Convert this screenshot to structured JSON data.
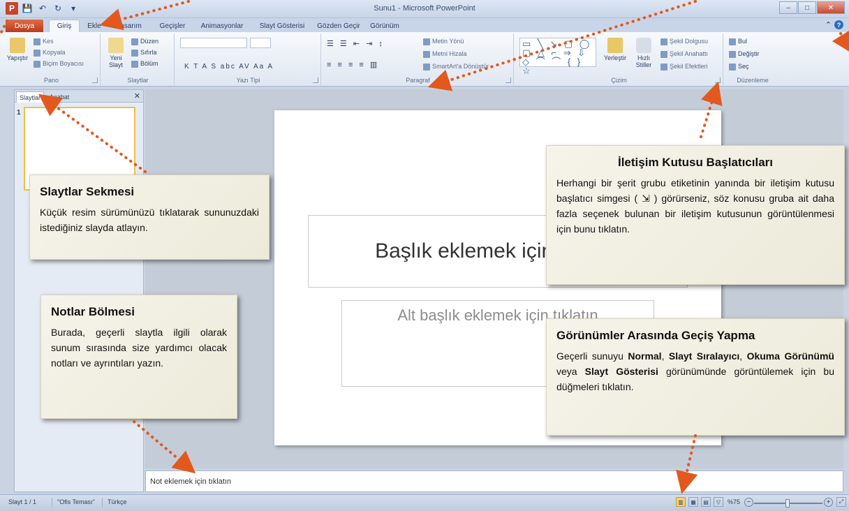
{
  "window": {
    "title": "Sunu1 - Microsoft PowerPoint",
    "minimize": "–",
    "maximize": "□",
    "close": "✕"
  },
  "qat": {
    "app_logo": "P",
    "save": "💾",
    "undo": "↶",
    "redo": "↻",
    "customize": "▾"
  },
  "tabs": {
    "file": "Dosya",
    "home": "Giriş",
    "insert": "Ekle",
    "design": "Tasarım",
    "transitions": "Geçişler",
    "animations": "Animasyonlar",
    "slideshow": "Slayt Gösterisi",
    "review": "Gözden Geçir",
    "view": "Görünüm",
    "help_caret": "⌃",
    "help": "?"
  },
  "ribbon": {
    "clipboard": {
      "label": "Pano",
      "paste": "Yapıştır",
      "cut": "Kes",
      "copy": "Kopyala",
      "format_painter": "Biçim Boyacısı"
    },
    "slides": {
      "label": "Slaytlar",
      "new_slide": "Yeni Slayt",
      "layout": "Düzen",
      "reset": "Sıfırla",
      "section": "Bölüm"
    },
    "font": {
      "label": "Yazı Tipi",
      "tools": "K  T  A  S  abc  AV  Aa  A"
    },
    "paragraph": {
      "label": "Paragraf",
      "text_direction": "Metin Yönü",
      "align_text": "Metni Hizala",
      "smartart": "SmartArt'a Dönüştür"
    },
    "drawing": {
      "label": "Çizim",
      "arrange": "Yerleştir",
      "quick_styles": "Hızlı Stiller",
      "shape_fill": "Şekil Dolgusu",
      "shape_outline": "Şekil Anahattı",
      "shape_effects": "Şekil Efektleri",
      "shapes": "▭ ╲ ↘ ▢ ◯ ▢ △ ⌐ ⇒ ⇩ ◇ ⌒ ⌒ { } ☆"
    },
    "editing": {
      "label": "Düzenleme",
      "find": "Bul",
      "replace": "Değiştir",
      "select": "Seç"
    }
  },
  "left_pane": {
    "tab_slides": "Slaytlar",
    "tab_outline": "Anahat",
    "close": "✕",
    "slide_number": "1"
  },
  "slide": {
    "title_placeholder": "Başlık eklemek için tıklatın",
    "subtitle_placeholder": "Alt başlık eklemek için tıklatın"
  },
  "notes": {
    "placeholder": "Not eklemek için tıklatın"
  },
  "status": {
    "slide": "Slayt 1 / 1",
    "theme": "\"Ofis Teması\"",
    "language": "Türkçe",
    "zoom": "%75",
    "zoom_minus": "−",
    "zoom_plus": "+",
    "fit": "⤢"
  },
  "callouts": {
    "slides_tab": {
      "title": "Slaytlar Sekmesi",
      "body": "Küçük resim sürümünüzü tıklatarak sununuzdaki istediğiniz slayda atlayın."
    },
    "notes_pane": {
      "title": "Notlar Bölmesi",
      "body": "Burada, geçerli slaytla ilgili olarak sunum sırasında size yardımcı olacak notları ve ayrıntıları yazın."
    },
    "dialog_launchers": {
      "title": "İletişim Kutusu Başlatıcıları",
      "body": "Herhangi bir şerit grubu etiketinin yanında bir iletişim kutusu başlatıcı simgesi ( ⇲ ) görürseniz, söz konusu gruba ait daha fazla seçenek bulunan bir iletişim kutusunun görüntülenmesi için bunu tıklatın."
    },
    "views": {
      "title": "Görünümler Arasında Geçiş Yapma",
      "body_1": "Geçerli sunuyu ",
      "normal": "Normal",
      "sep_1": ", ",
      "sorter": "Slayt Sıralayıcı",
      "sep_2": ", ",
      "reading": "Okuma Görünümü",
      "sep_3": " veya ",
      "slideshow": "Slayt Gösterisi",
      "body_2": " görünümünde görüntülemek için bu düğmeleri tıklatın."
    }
  },
  "colors": {
    "arrow": "#e2581d",
    "file_tab": "#c8431f",
    "ribbon": "#dfe7f2",
    "callout": "#f3f1e4"
  }
}
